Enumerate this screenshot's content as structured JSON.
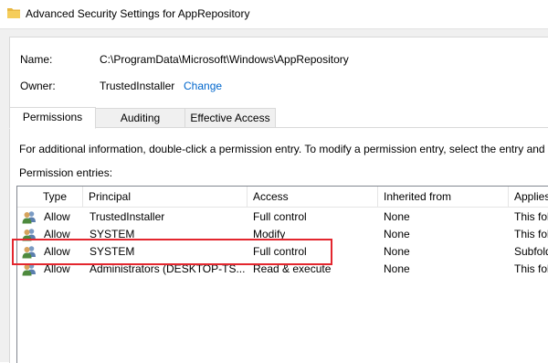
{
  "window": {
    "title": "Advanced Security Settings for AppRepository",
    "icon": "folder-icon"
  },
  "info": {
    "name_label": "Name:",
    "name_value": "C:\\ProgramData\\Microsoft\\Windows\\AppRepository",
    "owner_label": "Owner:",
    "owner_value": "TrustedInstaller",
    "change_link": "Change"
  },
  "tabs": [
    {
      "label": "Permissions",
      "active": true
    },
    {
      "label": "Auditing",
      "active": false
    },
    {
      "label": "Effective Access",
      "active": false
    }
  ],
  "panel": {
    "instructions": "For additional information, double-click a permission entry. To modify a permission entry, select the entry and",
    "entries_label": "Permission entries:"
  },
  "table": {
    "columns": [
      "Type",
      "Principal",
      "Access",
      "Inherited from",
      "Applies"
    ],
    "rows": [
      {
        "icon": "users-icon",
        "type": "Allow",
        "principal": "TrustedInstaller",
        "access": "Full control",
        "inherited_from": "None",
        "applies_to": "This fol"
      },
      {
        "icon": "users-icon",
        "type": "Allow",
        "principal": "SYSTEM",
        "access": "Modify",
        "inherited_from": "None",
        "applies_to": "This fol"
      },
      {
        "icon": "users-icon",
        "type": "Allow",
        "principal": "SYSTEM",
        "access": "Full control",
        "inherited_from": "None",
        "applies_to": "Subfold"
      },
      {
        "icon": "users-icon",
        "type": "Allow",
        "principal": "Administrators (DESKTOP-TS...",
        "access": "Read & execute",
        "inherited_from": "None",
        "applies_to": "This fol"
      }
    ]
  },
  "colors": {
    "link": "#0066cc",
    "highlight": "#e3262e",
    "window_bg": "#f0f0f0"
  }
}
